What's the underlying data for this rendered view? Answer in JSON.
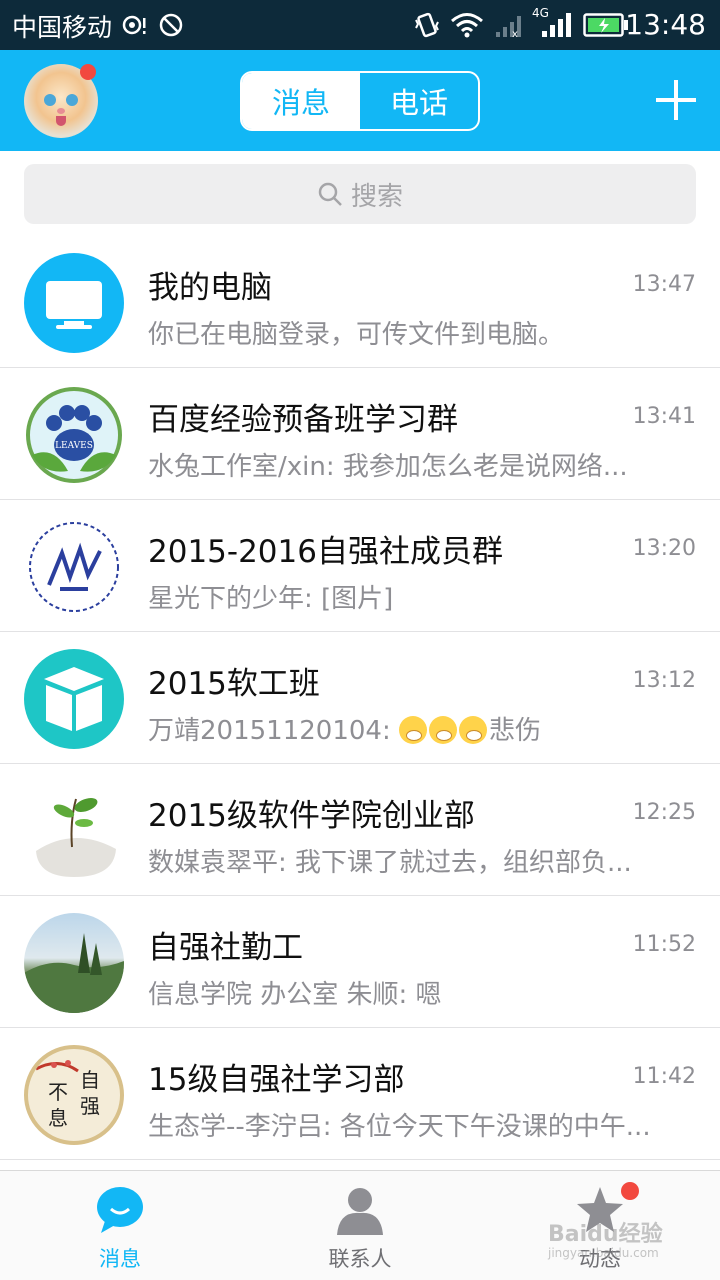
{
  "status_bar": {
    "carrier": "中国移动",
    "network": "4G",
    "time": "13:48",
    "icons": [
      "hd-voice-icon",
      "no-sim-icon",
      "vibrate-icon",
      "wifi-icon",
      "signal-icon",
      "signal-4g-icon",
      "battery-charging-icon"
    ]
  },
  "header": {
    "tabs": [
      {
        "label": "消息",
        "active": true
      },
      {
        "label": "电话",
        "active": false
      }
    ],
    "has_notification": true,
    "add_icon": "plus-icon"
  },
  "search": {
    "placeholder": "搜索",
    "icon": "search-icon"
  },
  "conversations": [
    {
      "name": "我的电脑",
      "time": "13:47",
      "message": "你已在电脑登录，可传文件到电脑。",
      "avatar": "monitor-icon"
    },
    {
      "name": "百度经验预备班学习群",
      "time": "13:41",
      "message": "水兔工作室/xin: 我参加怎么老是说网络...",
      "avatar": "paw-logo",
      "avatar_text": "LEAVES"
    },
    {
      "name": "2015-2016自强社成员群",
      "time": "13:20",
      "message": "星光下的少年: [图片]",
      "avatar": "club-logo"
    },
    {
      "name": "2015软工班",
      "time": "13:12",
      "message_prefix": "万靖20151120104: ",
      "message_suffix": "悲伤",
      "emoji_count": 3,
      "avatar": "book-icon"
    },
    {
      "name": "2015级软件学院创业部",
      "time": "12:25",
      "message": "数媒袁翠平: 我下课了就过去，组织部负...",
      "avatar": "plant-egg-photo"
    },
    {
      "name": "自强社勤工",
      "time": "11:52",
      "message": "信息学院   办公室  朱顺: 嗯",
      "avatar": "landscape-photo"
    },
    {
      "name": "15级自强社学习部",
      "time": "11:42",
      "message": "生态学--李泞吕: 各位今天下午没课的中午...",
      "avatar": "calligraphy-image",
      "avatar_text": [
        "不",
        "自",
        "息",
        "强"
      ]
    }
  ],
  "tab_bar": [
    {
      "label": "消息",
      "icon": "chat-bubble-icon",
      "active": true
    },
    {
      "label": "联系人",
      "icon": "person-icon",
      "active": false
    },
    {
      "label": "动态",
      "icon": "star-icon",
      "active": false,
      "has_notification": true
    }
  ],
  "watermark": {
    "text": "Baidu经验",
    "subtext": "jingyan.baidu.com"
  },
  "colors": {
    "accent": "#12b7f5",
    "status_bar": "#0d2a3a",
    "notification": "#f2493f",
    "muted_text": "#8e8e93",
    "search_bg": "#eeeeef"
  }
}
